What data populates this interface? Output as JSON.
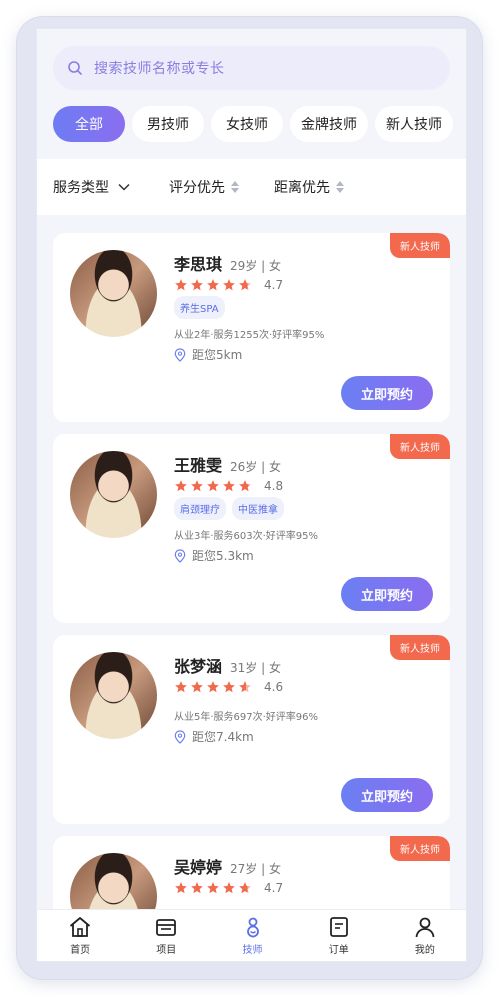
{
  "search": {
    "placeholder": "搜索技师名称或专长"
  },
  "categories": [
    "全部",
    "男技师",
    "女技师",
    "金牌技师",
    "新人技师"
  ],
  "active_category": "全部",
  "filters": {
    "service_type": "服务类型",
    "rating_first": "评分优先",
    "distance_first": "距离优先"
  },
  "technicians": [
    {
      "badge": "新人技师",
      "name": "李思琪",
      "meta": "29岁 | 女",
      "rating": "4.7",
      "rating_value": 4.7,
      "tags": [
        "养生SPA"
      ],
      "stats": "从业2年·服务1255次·好评率95%",
      "distance": "距您5km",
      "book_label": "立即预约"
    },
    {
      "badge": "新人技师",
      "name": "王雅雯",
      "meta": "26岁 | 女",
      "rating": "4.8",
      "rating_value": 4.8,
      "tags": [
        "肩颈理疗",
        "中医推拿"
      ],
      "stats": "从业3年·服务603次·好评率95%",
      "distance": "距您5.3km",
      "book_label": "立即预约"
    },
    {
      "badge": "新人技师",
      "name": "张梦涵",
      "meta": "31岁 | 女",
      "rating": "4.6",
      "rating_value": 4.6,
      "tags": [],
      "stats": "从业5年·服务697次·好评率96%",
      "distance": "距您7.4km",
      "book_label": "立即预约"
    },
    {
      "badge": "新人技师",
      "name": "吴婷婷",
      "meta": "27岁 | 女",
      "rating": "4.7",
      "rating_value": 4.7,
      "tags": [],
      "stats": "",
      "distance": "",
      "book_label": ""
    }
  ],
  "tabbar": [
    {
      "label": "首页",
      "icon": "home-icon"
    },
    {
      "label": "项目",
      "icon": "folder-icon"
    },
    {
      "label": "技师",
      "icon": "technician-icon",
      "active": true
    },
    {
      "label": "订单",
      "icon": "order-icon"
    },
    {
      "label": "我的",
      "icon": "user-icon"
    }
  ],
  "colors": {
    "accent": "#6b7ff3",
    "badge": "#f2694d",
    "star": "#f26a4d"
  }
}
